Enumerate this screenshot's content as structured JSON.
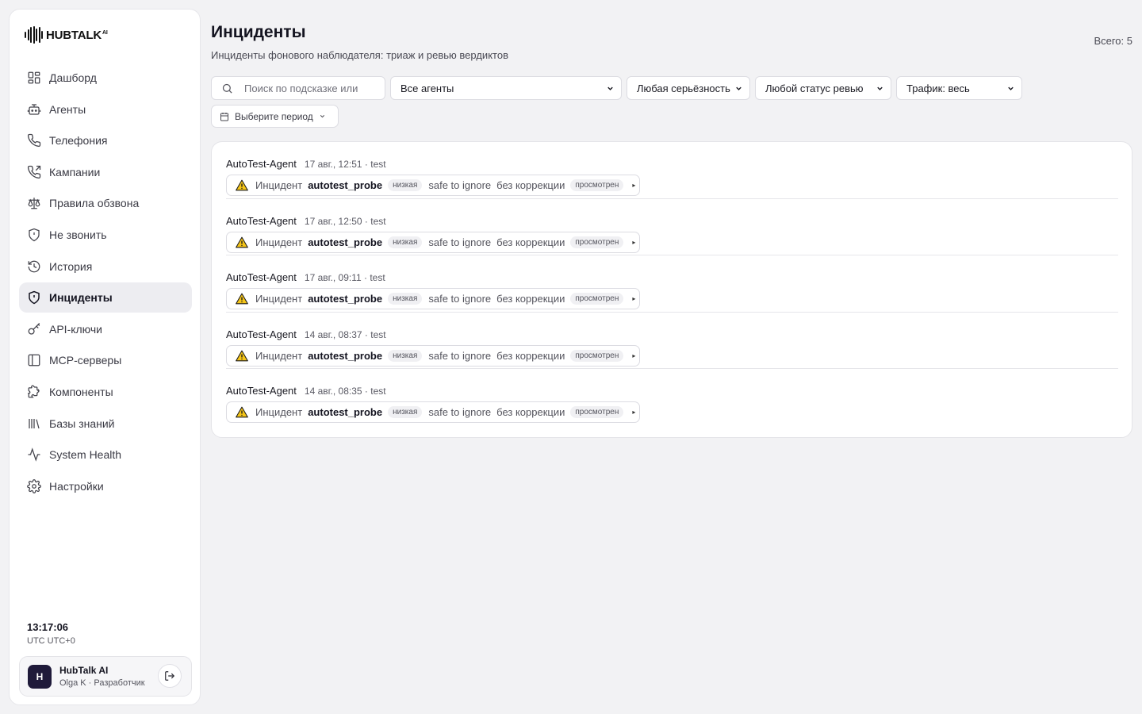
{
  "app": {
    "logo_text": "HUBTALK",
    "logo_sup": "AI"
  },
  "sidebar": {
    "items": [
      {
        "label": "Дашборд",
        "icon": "dashboard-icon",
        "active": false
      },
      {
        "label": "Агенты",
        "icon": "robot-icon",
        "active": false
      },
      {
        "label": "Телефония",
        "icon": "phone-icon",
        "active": false
      },
      {
        "label": "Кампании",
        "icon": "phone-outgoing-icon",
        "active": false
      },
      {
        "label": "Правила обзвона",
        "icon": "scale-icon",
        "active": false
      },
      {
        "label": "Не звонить",
        "icon": "shield-icon",
        "active": false
      },
      {
        "label": "История",
        "icon": "history-icon",
        "active": false
      },
      {
        "label": "Инциденты",
        "icon": "shield-alert-icon",
        "active": true
      },
      {
        "label": "API-ключи",
        "icon": "key-icon",
        "active": false
      },
      {
        "label": "MCP-серверы",
        "icon": "panel-icon",
        "active": false
      },
      {
        "label": "Компоненты",
        "icon": "puzzle-icon",
        "active": false
      },
      {
        "label": "Базы знаний",
        "icon": "library-icon",
        "active": false
      },
      {
        "label": "System Health",
        "icon": "activity-icon",
        "active": false
      },
      {
        "label": "Настройки",
        "icon": "gear-icon",
        "active": false
      }
    ],
    "clock": "13:17:06",
    "timezone": "UTC UTC+0",
    "user": {
      "avatar_letter": "H",
      "name": "HubTalk AI",
      "role": "Olga K · Разработчик"
    }
  },
  "header": {
    "title": "Инциденты",
    "subtitle": "Инциденты фонового наблюдателя: триаж и ревью вердиктов",
    "total": "Всего: 5"
  },
  "filters": {
    "search_placeholder": "Поиск по подсказке или",
    "agent": "Все агенты",
    "severity": "Любая серьёзность",
    "review_status": "Любой статус ревью",
    "traffic": "Трафик: весь",
    "period": "Выберите период"
  },
  "incidents": [
    {
      "agent": "AutoTest-Agent",
      "meta": "17 авг., 12:51 · test",
      "label": "Инцидент",
      "type": "autotest_probe",
      "severity": "низкая",
      "verdict": "safe to ignore",
      "correction": "без коррекции",
      "review": "просмотрен",
      "expand": "▸"
    },
    {
      "agent": "AutoTest-Agent",
      "meta": "17 авг., 12:50 · test",
      "label": "Инцидент",
      "type": "autotest_probe",
      "severity": "низкая",
      "verdict": "safe to ignore",
      "correction": "без коррекции",
      "review": "просмотрен",
      "expand": "▸"
    },
    {
      "agent": "AutoTest-Agent",
      "meta": "17 авг., 09:11 · test",
      "label": "Инцидент",
      "type": "autotest_probe",
      "severity": "низкая",
      "verdict": "safe to ignore",
      "correction": "без коррекции",
      "review": "просмотрен",
      "expand": "▸"
    },
    {
      "agent": "AutoTest-Agent",
      "meta": "14 авг., 08:37 · test",
      "label": "Инцидент",
      "type": "autotest_probe",
      "severity": "низкая",
      "verdict": "safe to ignore",
      "correction": "без коррекции",
      "review": "просмотрен",
      "expand": "▸"
    },
    {
      "agent": "AutoTest-Agent",
      "meta": "14 авг., 08:35 · test",
      "label": "Инцидент",
      "type": "autotest_probe",
      "severity": "низкая",
      "verdict": "safe to ignore",
      "correction": "без коррекции",
      "review": "просмотрен",
      "expand": "▸"
    }
  ]
}
